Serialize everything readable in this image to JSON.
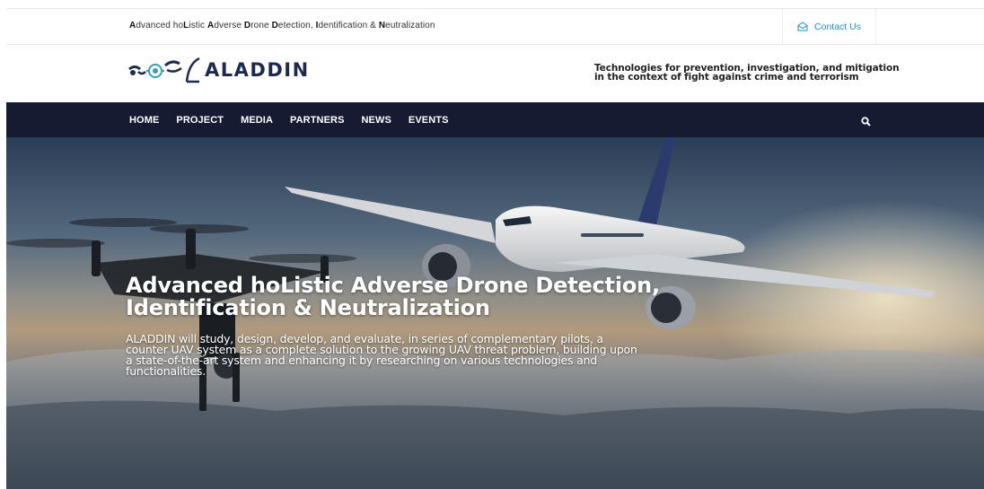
{
  "topbar": {
    "tagline": "Advanced hoListic Adverse Drone Detection, Identification & Neutralization",
    "contact_label": "Contact Us",
    "contact_icon": "envelope-open-icon"
  },
  "brand": {
    "name": "ALADDIN",
    "logo_icon": "drone-logo-icon",
    "slogan_line1": "Technologies for prevention, investigation, and mitigation",
    "slogan_line2": "in the context of fight against crime and terrorism"
  },
  "nav": {
    "items": [
      "HOME",
      "PROJECT",
      "MEDIA",
      "PARTNERS",
      "NEWS",
      "EVENTS"
    ],
    "search_icon": "search-icon"
  },
  "hero": {
    "title": "Advanced hoListic Adverse Drone Detection, Identification & Neutralization",
    "description": "ALADDIN will study, design, develop, and evaluate, in series of complementary pilots, a counter UAV system as a complete solution to the growing UAV threat problem, building upon a state-of-the-art system and enhancing it by researching on various technologies and functionalities."
  },
  "colors": {
    "nav_bg": "#161b32",
    "brand_navy": "#1c2a4e",
    "contact_blue": "#1f8fd1",
    "logo_teal": "#3a9fb6"
  }
}
